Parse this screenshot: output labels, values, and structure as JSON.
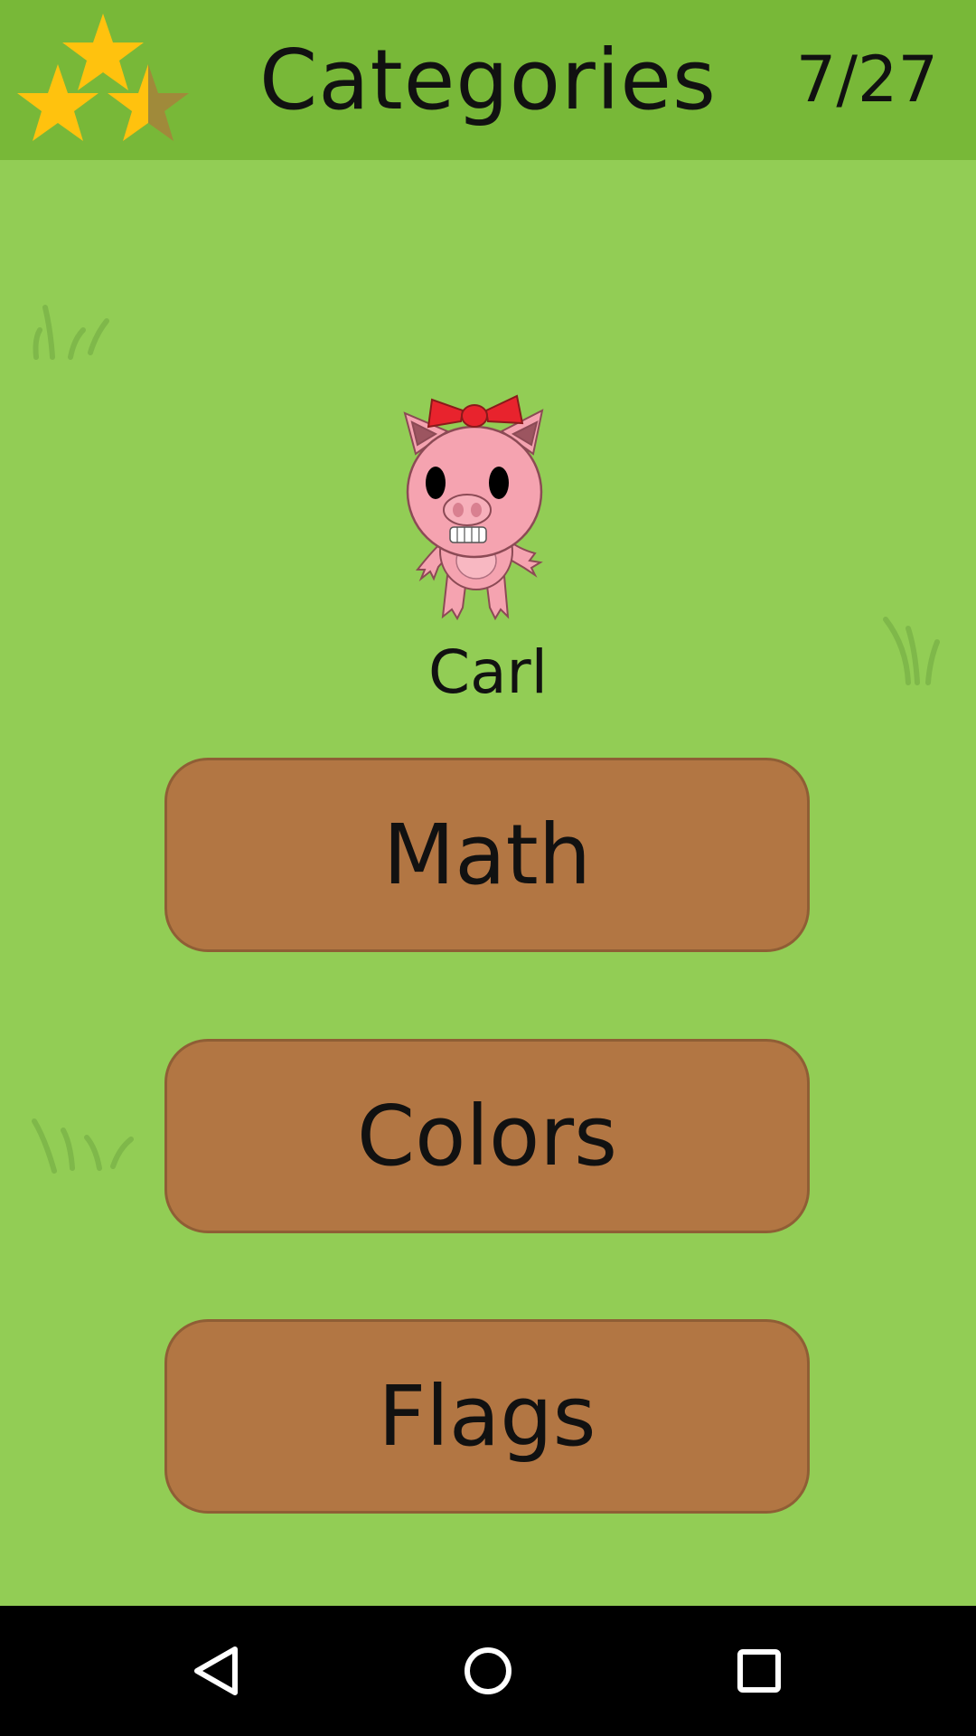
{
  "header": {
    "title": "Categories",
    "progress": "7/27",
    "stars_earned": 2.5,
    "stars_total": 3,
    "star_color": "#ffc20e"
  },
  "character": {
    "name": "Carl",
    "icon": "pig-with-bow-icon"
  },
  "categories": [
    {
      "label": "Math"
    },
    {
      "label": "Colors"
    },
    {
      "label": "Flags"
    }
  ],
  "navbar": {
    "back_icon": "back-triangle-icon",
    "home_icon": "home-circle-icon",
    "recents_icon": "recents-square-icon"
  },
  "colors": {
    "background": "#92cd55",
    "header": "#78b838",
    "button": "#b27643",
    "button_border": "#8f5e35",
    "navbar": "#000000"
  }
}
